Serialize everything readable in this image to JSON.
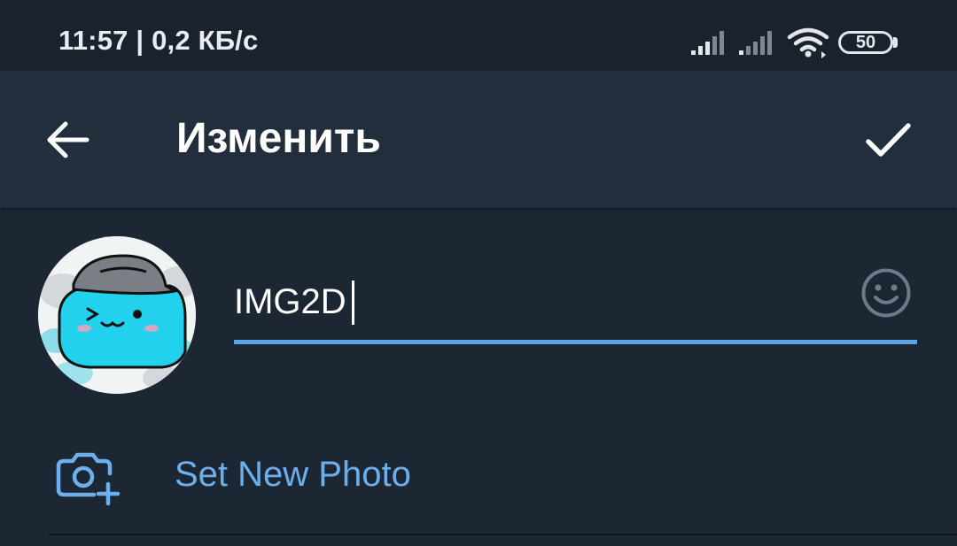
{
  "status_bar": {
    "time_and_speed": "11:57 | 0,2 КБ/с",
    "battery": "50",
    "icons": [
      "signal-icon",
      "signal-icon",
      "wifi-icon",
      "battery-icon"
    ]
  },
  "header": {
    "title": "Изменить",
    "back_icon": "arrow-left-icon",
    "done_icon": "checkmark-icon"
  },
  "profile": {
    "name_value": "IMG2D",
    "emoji_icon": "smiley-icon"
  },
  "set_photo": {
    "label": "Set New Photo",
    "icon": "camera-add-icon"
  },
  "colors": {
    "background": "#1d2733",
    "header": "#222e3b",
    "status_bar": "#1a222d",
    "accent": "#5aa4e7",
    "link_text": "#6bb0ec"
  }
}
